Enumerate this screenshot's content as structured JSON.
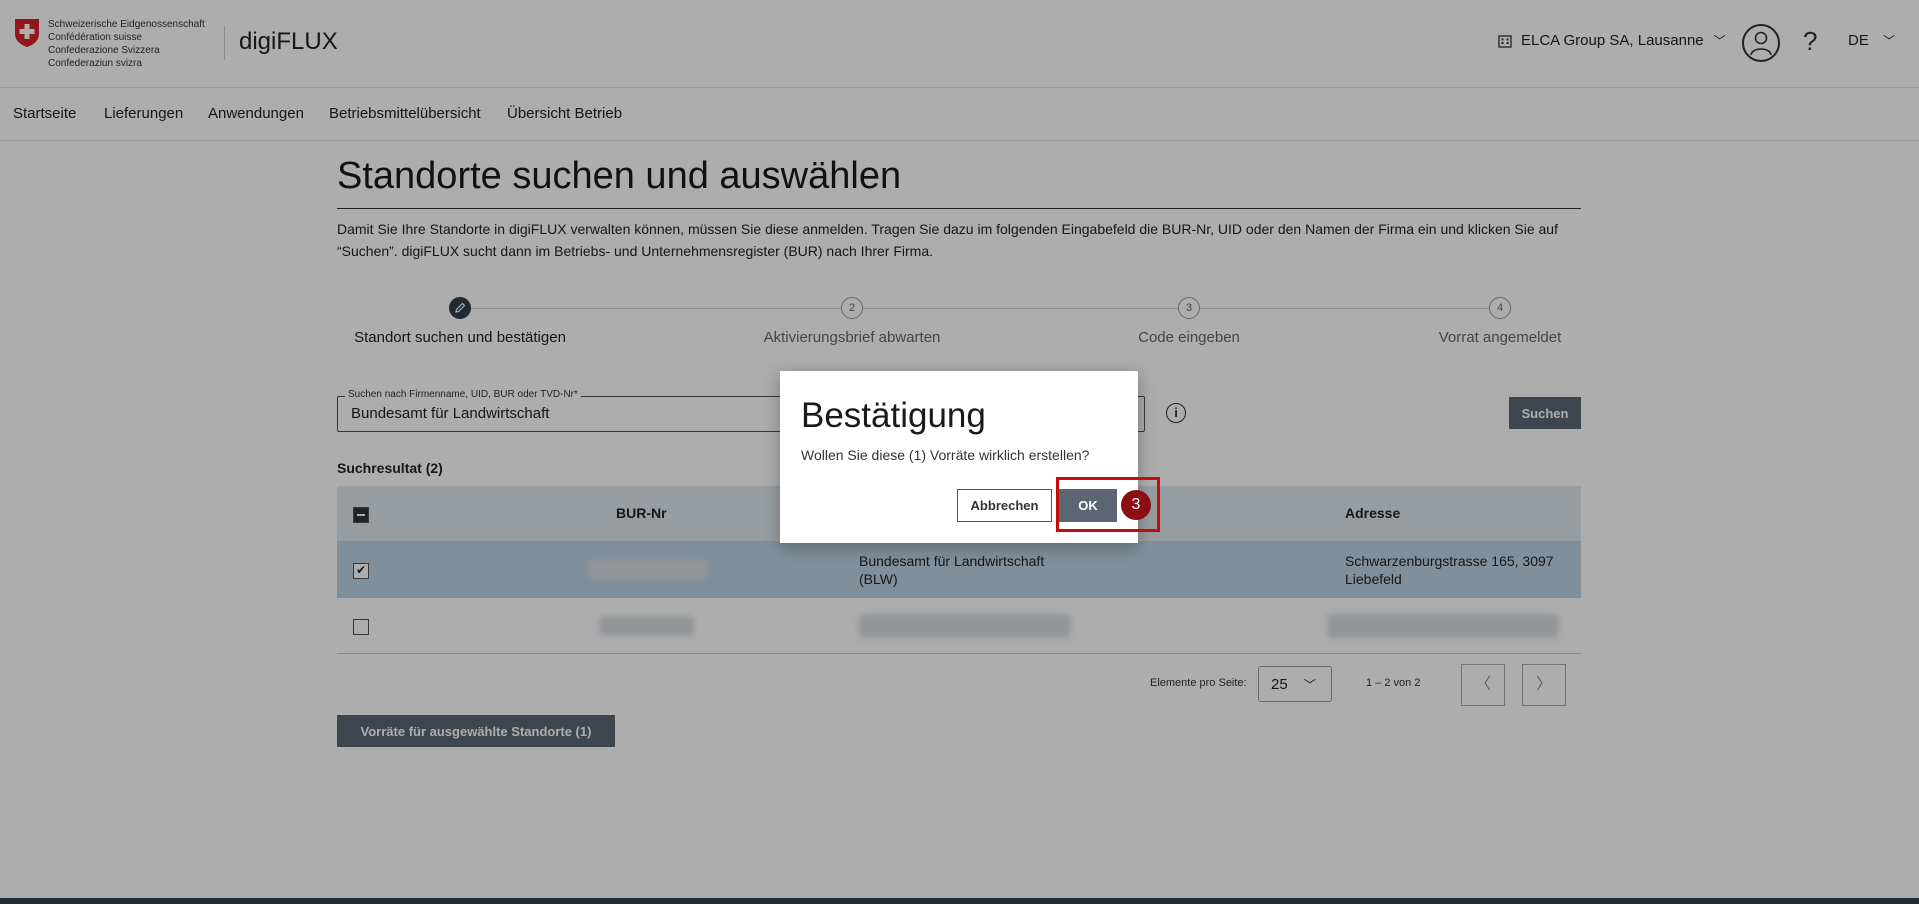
{
  "header": {
    "confederation": [
      "Schweizerische Eidgenossenschaft",
      "Confédération suisse",
      "Confederazione Svizzera",
      "Confederaziun svizra"
    ],
    "app_name": "digiFLUX",
    "org_label": "ELCA Group SA, Lausanne",
    "language": "DE",
    "help_label": "?"
  },
  "nav": {
    "items": [
      "Startseite",
      "Lieferungen",
      "Anwendungen",
      "Betriebsmittelübersicht",
      "Übersicht Betrieb"
    ]
  },
  "main": {
    "title": "Standorte suchen und auswählen",
    "intro": "Damit Sie Ihre Standorte in digiFLUX verwalten können, müssen Sie diese anmelden. Tragen Sie dazu im folgenden Eingabefeld die BUR-Nr, UID oder den Namen der Firma ein und klicken Sie auf “Suchen”. digiFLUX sucht dann im Betriebs- und Unternehmensregister (BUR) nach Ihrer Firma.",
    "steps": [
      {
        "number": "",
        "label": "Standort suchen und bestätigen",
        "active": true
      },
      {
        "number": "2",
        "label": "Aktivierungsbrief abwarten",
        "active": false
      },
      {
        "number": "3",
        "label": "Code eingeben",
        "active": false
      },
      {
        "number": "4",
        "label": "Vorrat angemeldet",
        "active": false
      }
    ],
    "search": {
      "legend": "Suchen nach Firmenname, UID, BUR oder TVD-Nr*",
      "value": "Bundesamt für Landwirtschaft",
      "button": "Suchen"
    },
    "result_label": "Suchresultat (2)",
    "table": {
      "columns": [
        "BUR-Nr",
        "Adresse"
      ],
      "rows": [
        {
          "selected": true,
          "name_line1": "Bundesamt für Landwirtschaft",
          "name_line2": "(BLW)",
          "address_line1": "Schwarzenburgstrasse 165, 3097",
          "address_line2": "Liebefeld"
        },
        {
          "selected": false
        }
      ]
    },
    "pagination": {
      "per_page_label": "Elemente pro Seite:",
      "per_page_value": "25",
      "range": "1 – 2 von 2"
    },
    "submit_button": "Vorräte für ausgewählte Standorte (1)"
  },
  "dialog": {
    "title": "Bestätigung",
    "message": "Wollen Sie diese (1) Vorräte wirklich erstellen?",
    "cancel": "Abbrechen",
    "ok": "OK",
    "step_badge": "3"
  },
  "colors": {
    "primary_button": "#5a6673",
    "highlight": "#c30d0d",
    "badge": "#8b0f12"
  }
}
